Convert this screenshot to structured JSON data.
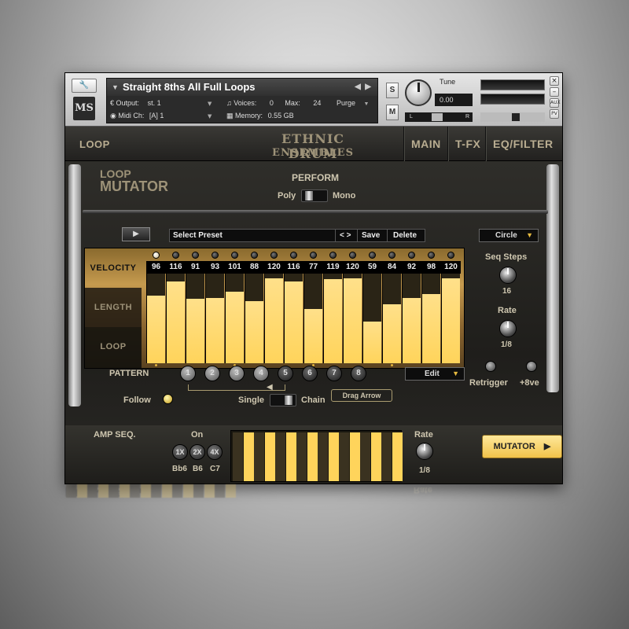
{
  "header": {
    "instrument_name": "Straight 8ths All Full Loops",
    "output_label": "Output:",
    "output_value": "st. 1",
    "voices_label": "Voices:",
    "voices_value": "0",
    "max_label": "Max:",
    "max_value": "24",
    "purge_label": "Purge",
    "midi_label": "Midi Ch:",
    "midi_value": "[A]  1",
    "memory_label": "Memory:",
    "memory_value": "0.55 GB",
    "s_label": "S",
    "m_label": "M",
    "tune_label": "Tune",
    "tune_value": "0.00",
    "pan_l": "L",
    "pan_r": "R",
    "aux_label": "AUX",
    "pv_label": "PV",
    "logo_text": "MS"
  },
  "nav": {
    "page_label": "LOOP",
    "title_line1": "ETHNIC DRUM",
    "title_line2": "ENSEMBLES",
    "tabs": [
      "MAIN",
      "T-FX",
      "EQ/FILTER"
    ]
  },
  "mutator": {
    "title_small": "LOOP",
    "title_big": "MUTATOR",
    "perform_label": "PERFORM",
    "poly_label": "Poly",
    "mono_label": "Mono",
    "preset_placeholder": "Select Preset",
    "preset_arrows": "< >",
    "save_label": "Save",
    "delete_label": "Delete",
    "mode_value": "Circle",
    "tabs": [
      "VELOCITY",
      "LENGTH",
      "LOOP"
    ],
    "velocity_values": [
      96,
      116,
      91,
      93,
      101,
      88,
      120,
      116,
      77,
      119,
      120,
      59,
      84,
      92,
      98,
      120
    ],
    "velocity_max": 127,
    "seq_steps_label": "Seq Steps",
    "seq_steps_value": "16",
    "rate_label": "Rate",
    "rate_value": "1/8",
    "retrigger_label": "Retrigger",
    "plus8ve_label": "+8ve",
    "pattern_label": "PATTERN",
    "patterns": [
      "1",
      "2",
      "3",
      "4",
      "5",
      "6",
      "7",
      "8"
    ],
    "edit_label": "Edit",
    "follow_label": "Follow",
    "single_label": "Single",
    "chain_label": "Chain",
    "drag_arrow_label": "Drag Arrow"
  },
  "amp_seq": {
    "label": "AMP SEQ.",
    "on_label": "On",
    "speed_buttons": [
      "1X",
      "2X",
      "4X"
    ],
    "notes": [
      "Bb6",
      "B6",
      "C7"
    ],
    "rate_label": "Rate",
    "rate_value": "1/8",
    "steps": [
      0,
      1,
      0,
      1,
      0,
      1,
      0,
      1,
      0,
      1,
      0,
      1,
      0,
      1,
      0,
      1
    ],
    "mutator_button": "MUTATOR"
  },
  "colors": {
    "accent": "#ffd45b",
    "bar_fill": "#ffd860",
    "background_dark": "#1c1c1a",
    "label_text": "#cfc7b0"
  }
}
